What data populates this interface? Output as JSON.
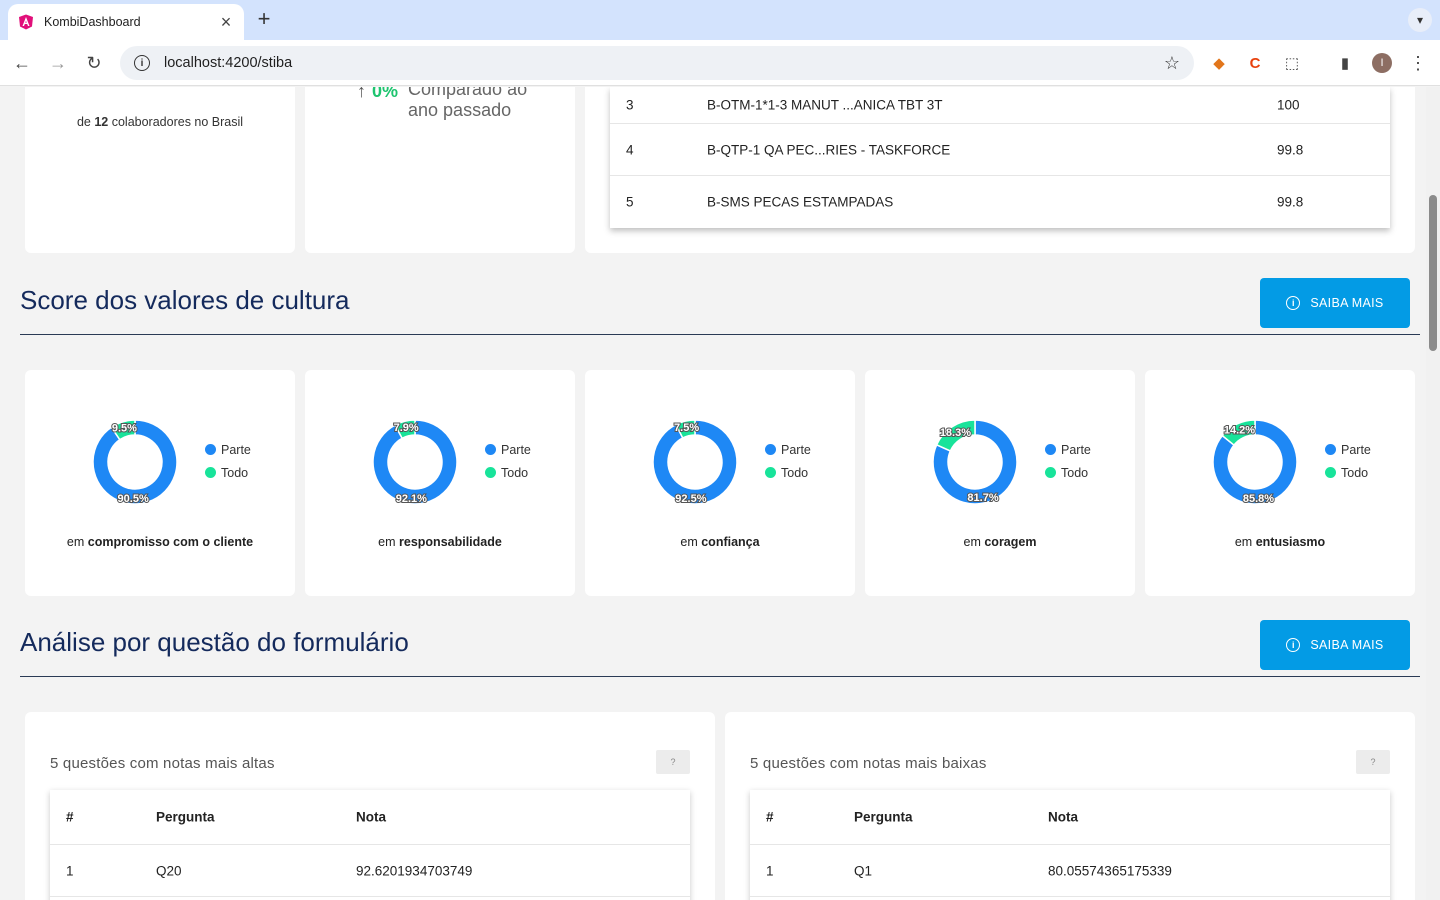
{
  "browser": {
    "tab_title": "KombiDashboard",
    "tab_close": "×",
    "new_tab": "+",
    "url": "localhost:4200/stiba",
    "avatar_letter": "I"
  },
  "summary": {
    "collab_prefix": "de ",
    "collab_count": "12",
    "collab_suffix": " colaboradores no Brasil",
    "compare_arrow": "↑",
    "compare_pct": "0%",
    "compare_text": "Comparado ao ano passado"
  },
  "ranking": {
    "rows": [
      {
        "rank": "3",
        "name": "B-OTM-1*1-3 MANUT ...ANICA TBT 3T",
        "score": "100"
      },
      {
        "rank": "4",
        "name": "B-QTP-1 QA PEC...RIES - TASKFORCE",
        "score": "99.8"
      },
      {
        "rank": "5",
        "name": "B-SMS PECAS ESTAMPADAS",
        "score": "99.8"
      }
    ]
  },
  "culture": {
    "title": "Score dos valores de cultura",
    "button": "SAIBA MAIS",
    "legend_parte": "Parte",
    "legend_todo": "Todo",
    "color_parte": "#1e88f5",
    "color_todo": "#18e39a",
    "caption_prefix": "em ",
    "donuts": [
      {
        "value": "compromisso com o cliente",
        "parte": 90.5,
        "todo": 9.5,
        "parte_label": "90.5%",
        "todo_label": "9.5%"
      },
      {
        "value": "responsabilidade",
        "parte": 92.1,
        "todo": 7.9,
        "parte_label": "92.1%",
        "todo_label": "7.9%"
      },
      {
        "value": "confiança",
        "parte": 92.5,
        "todo": 7.5,
        "parte_label": "92.5%",
        "todo_label": "7.5%"
      },
      {
        "value": "coragem",
        "parte": 81.7,
        "todo": 18.3,
        "parte_label": "81.7%",
        "todo_label": "18.3%"
      },
      {
        "value": "entusiasmo",
        "parte": 85.8,
        "todo": 14.2,
        "parte_label": "85.8%",
        "todo_label": "14.2%"
      }
    ]
  },
  "analysis": {
    "title": "Análise por questão do formulário",
    "button": "SAIBA MAIS",
    "help": "?",
    "high": {
      "title": "5 questões com notas mais altas",
      "headers": [
        "#",
        "Pergunta",
        "Nota"
      ],
      "rows": [
        {
          "n": "1",
          "q": "Q20",
          "nota": "92.6201934703749"
        }
      ]
    },
    "low": {
      "title": "5 questões com notas mais baixas",
      "headers": [
        "#",
        "Pergunta",
        "Nota"
      ],
      "rows": [
        {
          "n": "1",
          "q": "Q1",
          "nota": "80.05574365175339"
        }
      ]
    }
  }
}
